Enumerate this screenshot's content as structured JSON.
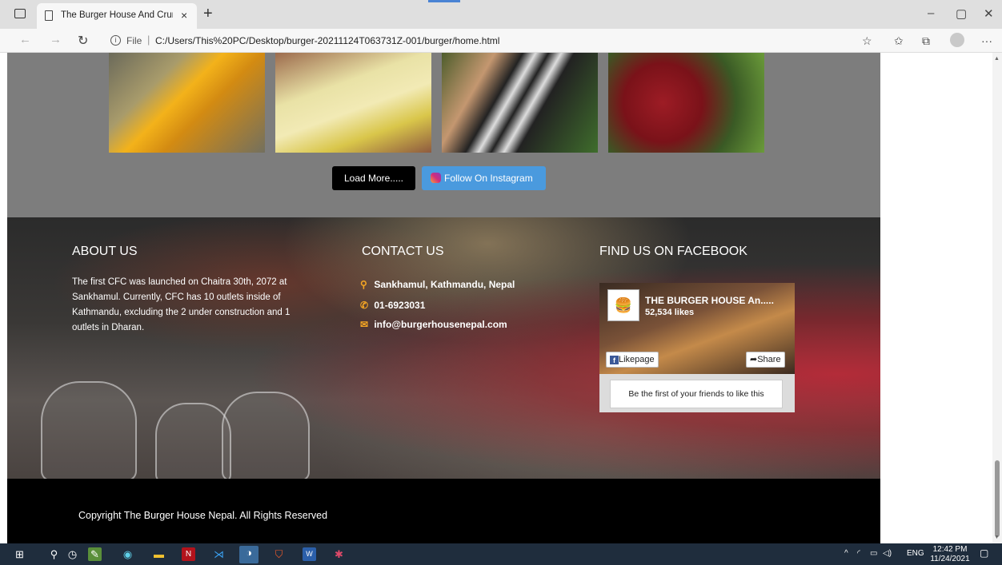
{
  "browser": {
    "tab_title": "The Burger House And Crunchy Fried Chicken",
    "tab_close": "×",
    "new_tab": "+",
    "file_label": "File",
    "url": "C:/Users/This%20PC/Desktop/burger-20211124T063731Z-001/burger/home.html",
    "window_controls": {
      "minimize": "–",
      "restore": "▢",
      "close": "✕"
    },
    "icons": [
      "tab-actions-icon",
      "back-icon",
      "forward-icon",
      "reload-icon",
      "info-icon",
      "read-aloud-icon",
      "favorites-icon",
      "collections-icon",
      "profile-icon",
      "more-icon"
    ]
  },
  "gallery": {
    "load_more_label": "Load More.....",
    "instagram_label": "Follow On Instagram"
  },
  "footer": {
    "about": {
      "title": "ABOUT US",
      "text": "The first CFC was launched on Chaitra 30th, 2072 at Sankhamul. Currently, CFC has 10 outlets inside of Kathmandu, excluding the 2 under construction and 1 outlets in Dharan."
    },
    "contact": {
      "title": "CONTACT US",
      "address": "Sankhamul, Kathmandu, Nepal",
      "phone": "01-6923031",
      "email": "info@burgerhousenepal.com"
    },
    "facebook": {
      "title": "FIND US ON FACEBOOK",
      "page_name": "THE BURGER HOUSE An.....",
      "likes": "52,534 likes",
      "like_button": "Likepage",
      "share_button": "Share",
      "friends_text": "Be the first of your friends to like this"
    },
    "copyright": "Copyright The Burger House Nepal. All Rights Reserved"
  },
  "taskbar": {
    "language": "ENG",
    "time": "12:42 PM",
    "date": "11/24/2021"
  }
}
